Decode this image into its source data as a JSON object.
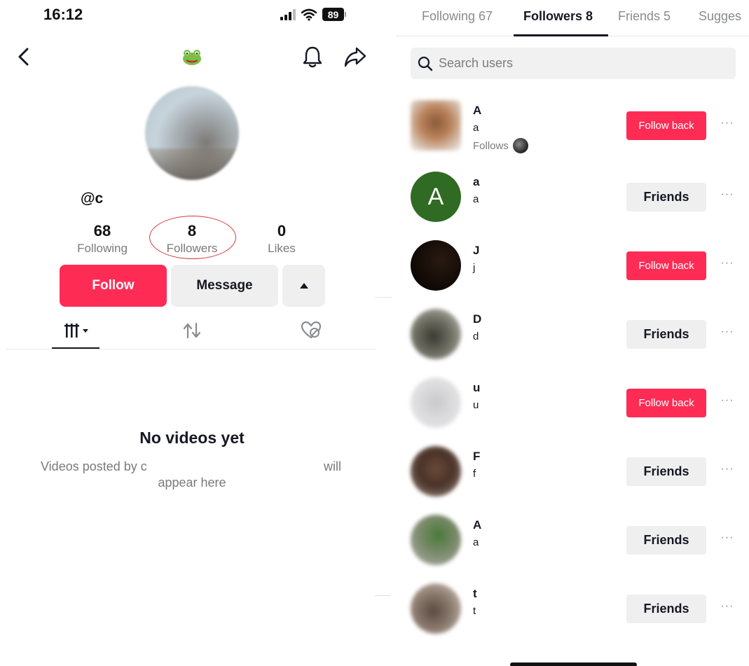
{
  "status_bar": {
    "time": "16:12",
    "battery": "89"
  },
  "profile": {
    "username": "@c",
    "stats": {
      "following": {
        "count": "68",
        "label": "Following"
      },
      "followers": {
        "count": "8",
        "label": "Followers"
      },
      "likes": {
        "count": "0",
        "label": "Likes"
      }
    },
    "buttons": {
      "follow": "Follow",
      "message": "Message"
    },
    "empty_state": {
      "title": "No videos yet",
      "line1_start": "Videos posted by c",
      "line1_end": "will",
      "line2": "appear here"
    }
  },
  "followers_panel": {
    "tabs": [
      {
        "label": "Following 67",
        "active": false
      },
      {
        "label": "Followers 8",
        "active": true
      },
      {
        "label": "Friends 5",
        "active": false
      },
      {
        "label": "Sugges",
        "active": false
      }
    ],
    "search": {
      "placeholder": "Search users",
      "value": ""
    },
    "rows": [
      {
        "name": "A",
        "handle": "a",
        "note": "Follows",
        "button": "Follow back",
        "style": "pink"
      },
      {
        "name": "a",
        "handle": "a",
        "avatar_letter": "A",
        "button": "Friends",
        "style": "gray"
      },
      {
        "name": "J",
        "handle": "j",
        "button": "Follow back",
        "style": "pink"
      },
      {
        "name": "D",
        "handle": "d",
        "button": "Friends",
        "style": "gray"
      },
      {
        "name": "u",
        "handle": "u",
        "button": "Follow back",
        "style": "pink"
      },
      {
        "name": "F",
        "handle": "f",
        "button": "Friends",
        "style": "gray"
      },
      {
        "name": "A",
        "handle": "a",
        "button": "Friends",
        "style": "gray"
      },
      {
        "name": "t",
        "handle": "t",
        "button": "Friends",
        "style": "gray"
      }
    ],
    "more_glyph": "···"
  },
  "colors": {
    "accent": "#fe2c55",
    "gray_button": "#efeff0",
    "annotation_ring": "#d6383a"
  },
  "icons": [
    "back-icon",
    "frog-emoji-icon",
    "bell-icon",
    "share-icon",
    "grid-icon",
    "repost-icon",
    "liked-hidden-icon",
    "search-icon",
    "more-icon"
  ]
}
